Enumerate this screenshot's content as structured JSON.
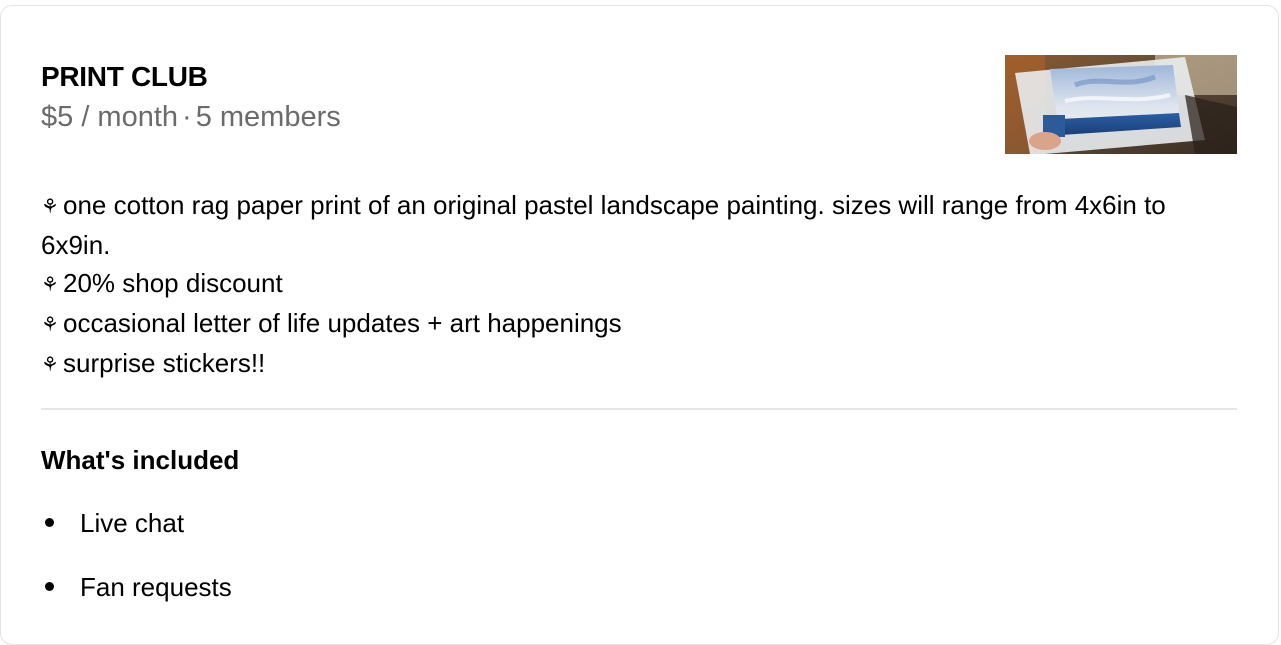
{
  "tier": {
    "name": "PRINT CLUB",
    "price": "$5 / month",
    "separator": "·",
    "members": "5 members",
    "thumbnail_icon": "painting-photo-thumbnail"
  },
  "description": {
    "bullet_glyph": "⚘",
    "lines": [
      "one cotton rag paper print of an original pastel landscape painting. sizes will range from 4x6in to 6x9in.",
      "20% shop discount",
      "occasional letter of life updates + art happenings",
      "surprise stickers!!"
    ]
  },
  "included": {
    "heading": "What's included",
    "items": [
      "Live chat",
      "Fan requests"
    ]
  },
  "colors": {
    "meta_text": "#6b6b6b",
    "divider": "#e6e6e6",
    "card_border": "#e4e4e4"
  }
}
